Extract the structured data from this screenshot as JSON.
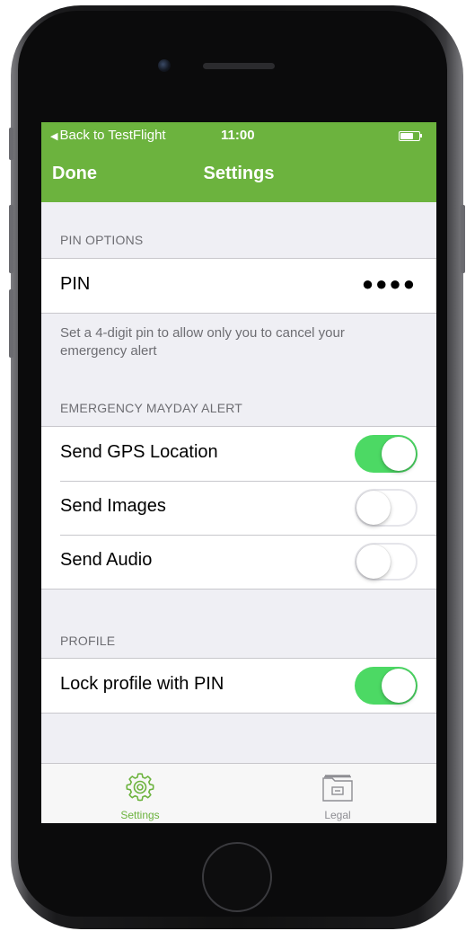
{
  "status_bar": {
    "back_label": "Back to TestFlight",
    "time": "11:00"
  },
  "nav": {
    "done_label": "Done",
    "title": "Settings"
  },
  "pin_section": {
    "header": "PIN OPTIONS",
    "pin_label": "PIN",
    "pin_value": "●●●●",
    "footer": "Set a 4-digit pin to allow only you to cancel your emergency alert"
  },
  "alert_section": {
    "header": "EMERGENCY MAYDAY ALERT",
    "items": [
      {
        "label": "Send GPS Location",
        "on": true
      },
      {
        "label": "Send Images",
        "on": false
      },
      {
        "label": "Send Audio",
        "on": false
      }
    ]
  },
  "profile_section": {
    "header": "PROFILE",
    "items": [
      {
        "label": "Lock profile with PIN",
        "on": true
      }
    ]
  },
  "tabbar": {
    "tabs": [
      {
        "label": "Settings",
        "icon": "gear-icon",
        "active": true
      },
      {
        "label": "Legal",
        "icon": "folder-icon",
        "active": false
      }
    ]
  },
  "colors": {
    "accent": "#6cb33e",
    "toggle_on": "#4cd964",
    "tab_inactive": "#8e8e93"
  }
}
